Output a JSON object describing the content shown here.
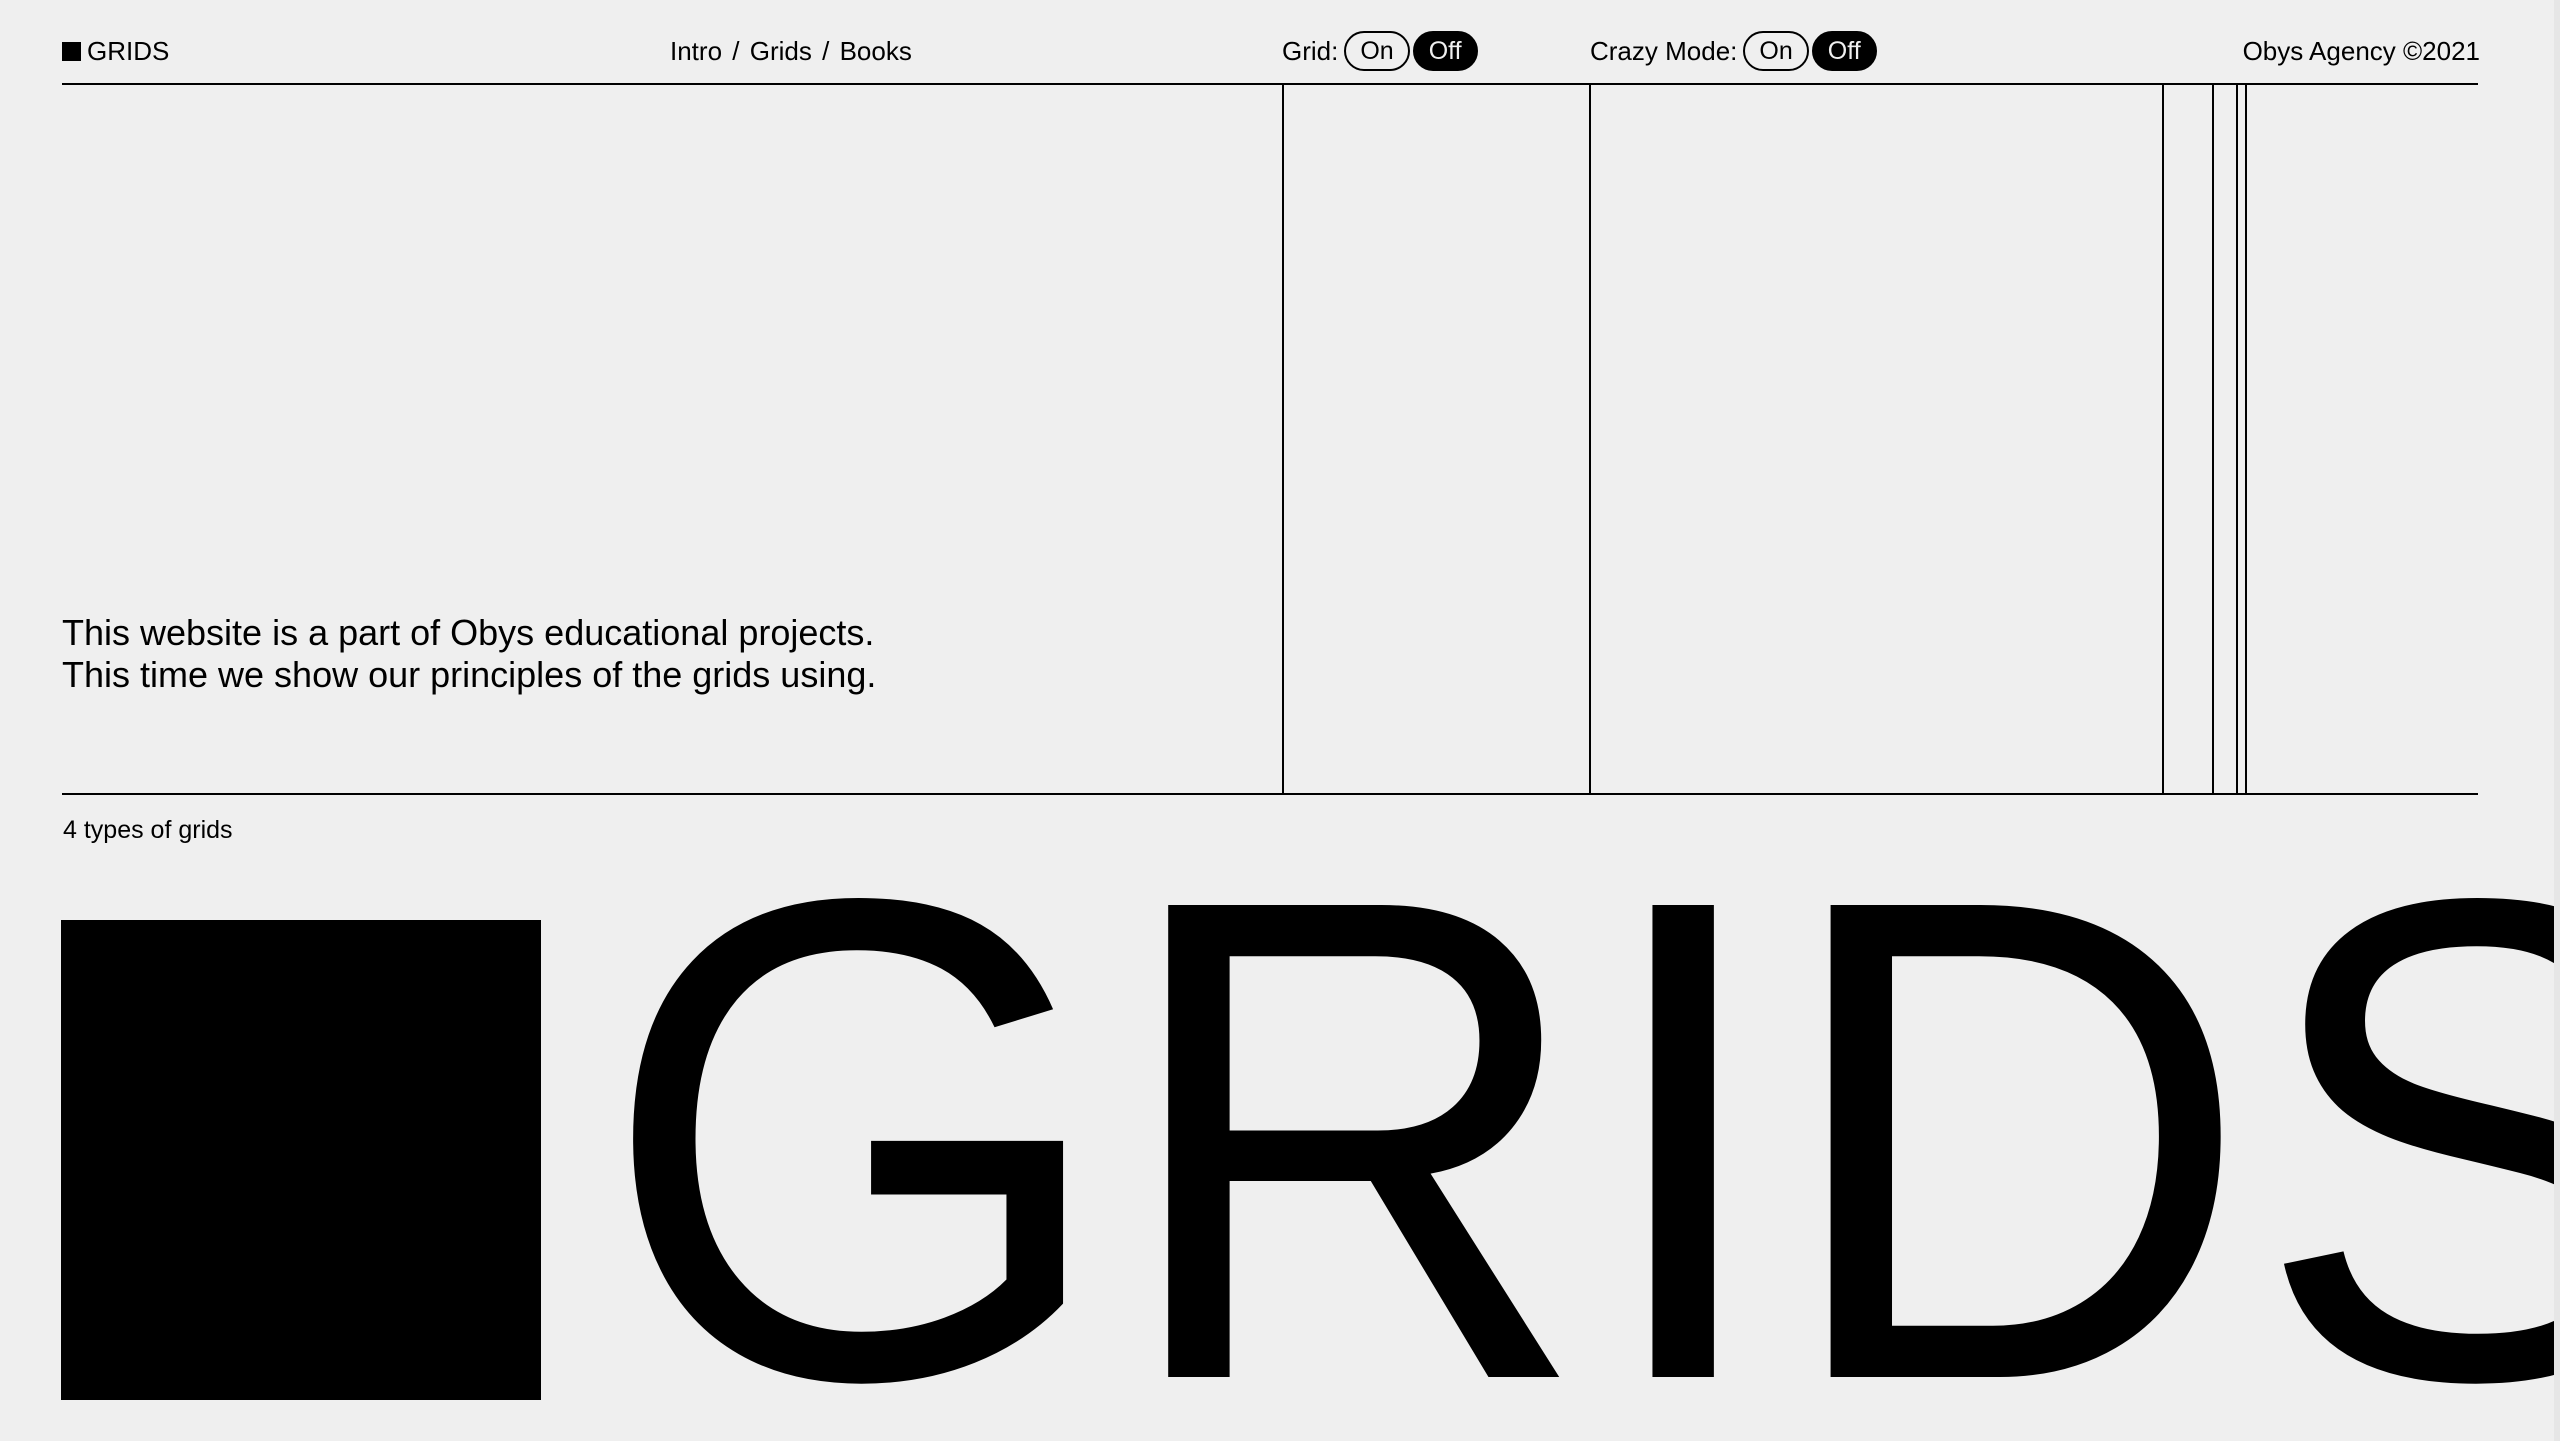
{
  "header": {
    "brand": "GRIDS",
    "breadcrumb": [
      "Intro",
      "Grids",
      "Books"
    ],
    "breadcrumb_separator": "/",
    "grid_toggle": {
      "label": "Grid:",
      "on": "On",
      "off": "Off",
      "selected": "Off"
    },
    "crazy_toggle": {
      "label": "Crazy Mode:",
      "on": "On",
      "off": "Off",
      "selected": "Off"
    },
    "copyright": "Obys Agency ©2021"
  },
  "intro": {
    "line1": "This website is a part of Obys educational projects.",
    "line2": "This time we show our principles of the grids using."
  },
  "section": {
    "caption": "4 types of grids",
    "title": "GRIDS"
  },
  "colors": {
    "background": "#efefef",
    "foreground": "#000000"
  }
}
